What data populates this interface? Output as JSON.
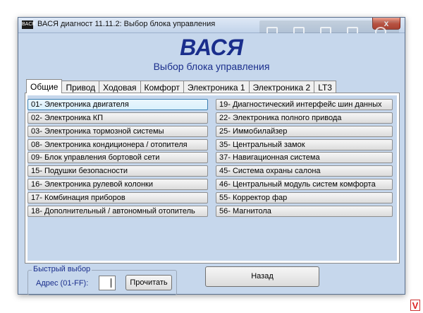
{
  "window": {
    "title": "ВАСЯ диагност 11.11.2:  Выбор блока управления",
    "app_icon_text": "BACR",
    "close_glyph": "x"
  },
  "header": {
    "title": "ВАСЯ",
    "subtitle": "Выбор блока управления"
  },
  "tabs": [
    {
      "label": "Общие",
      "active": true
    },
    {
      "label": "Привод"
    },
    {
      "label": "Ходовая"
    },
    {
      "label": "Комфорт"
    },
    {
      "label": "Электроника 1"
    },
    {
      "label": "Электроника 2"
    },
    {
      "label": "LT3"
    }
  ],
  "modules_left": [
    "01- Электроника двигателя",
    "02- Электроника КП",
    "03- Электроника тормозной системы",
    "08- Электроника кондиционера / отопителя",
    "09- Блок управления бортовой сети",
    "15- Подушки безопасности",
    "16- Электроника рулевой колонки",
    "17- Комбинация приборов",
    "18- Дополнительный / автономный отопитель"
  ],
  "modules_right": [
    "19- Диагностический интерфейс шин данных",
    "22- Электроника полного привода",
    "25- Иммобилайзер",
    "35- Центральный замок",
    "37- Навигационная система",
    "45- Система охраны салона",
    "46- Центральный модуль систем комфорта",
    "55- Корректор фар",
    "56- Магнитола"
  ],
  "quick_select": {
    "legend": "Быстрый выбор",
    "address_label": "Адрес (01-FF):",
    "address_value": "",
    "read_button": "Прочитать"
  },
  "back_button": "Назад",
  "watermark": "V"
}
